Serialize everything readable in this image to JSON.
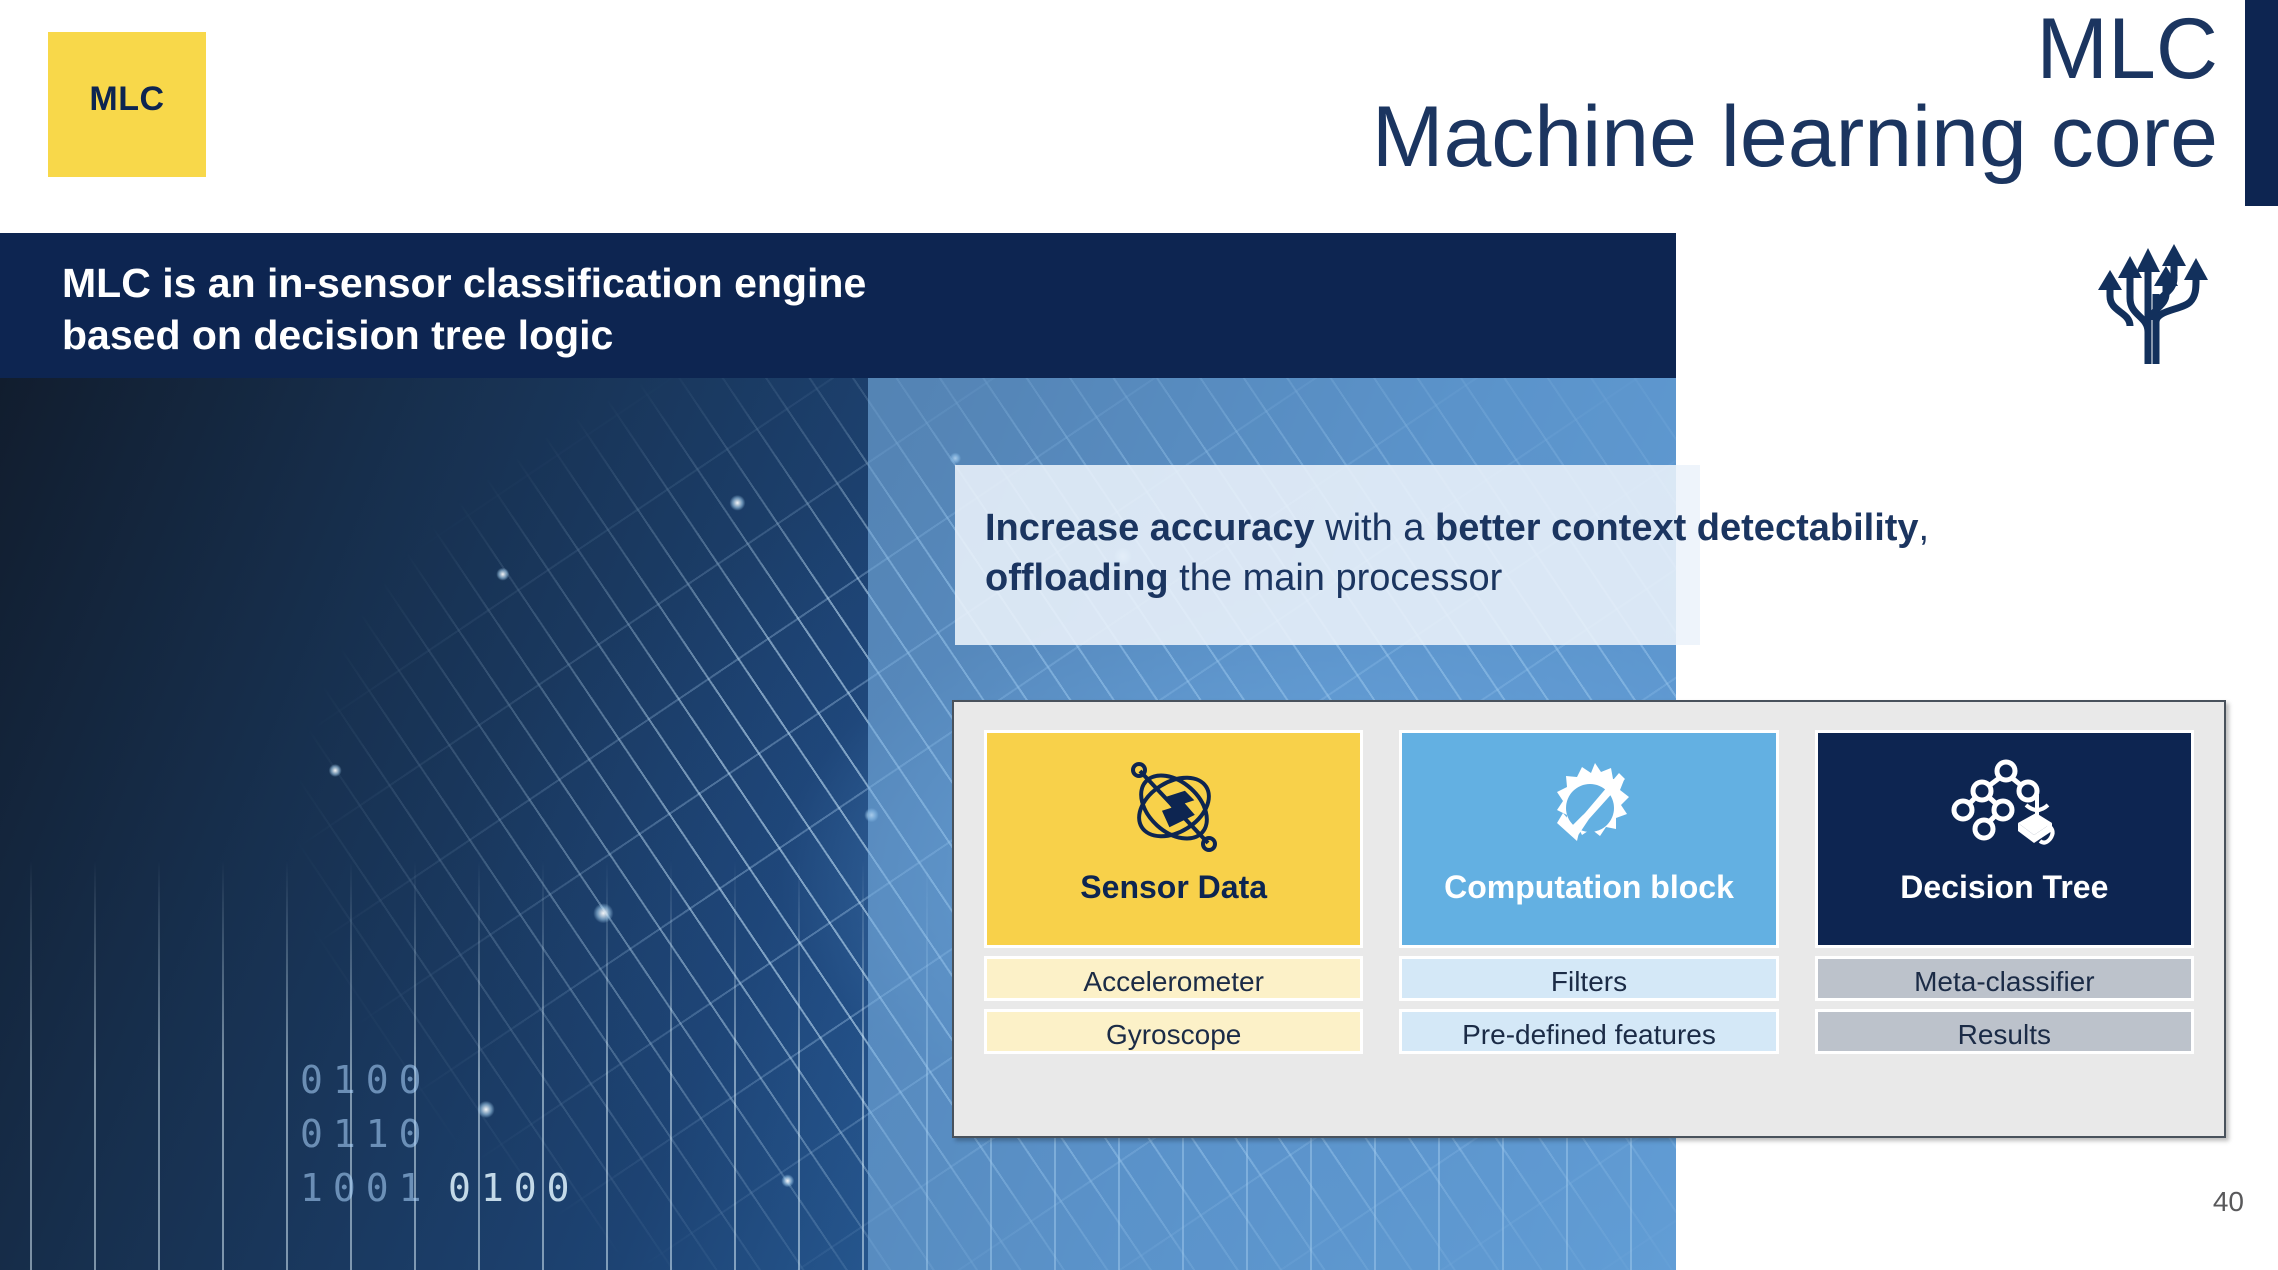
{
  "slide": {
    "page_number": "40",
    "logo_chip": {
      "label": "MLC",
      "bg_color": "#f8d84a",
      "text_color": "#0d2551"
    },
    "title": {
      "line1": "MLC",
      "line2": "Machine learning core",
      "color": "#1b3560"
    },
    "banner": {
      "line1": "MLC is an in-sensor classification engine",
      "line2": "based on decision tree logic",
      "bg_color": "#0d2551",
      "text_color": "#ffffff"
    },
    "decorative_icon": "branching-arrows-icon",
    "callout": {
      "bold1": "Increase accuracy",
      "plain1": " with a ",
      "bold2": "better context detectability",
      "plain2": ",",
      "bold3": "offloading",
      "plain3": " the main processor",
      "bg_color": "#ecf3fa",
      "text_color": "#1b3560"
    },
    "background_art": {
      "description": "circuit-board brain",
      "binary_rows": [
        "0100",
        "0110",
        "1001",
        "0100"
      ]
    },
    "pipeline": {
      "panel_bg": "#e9e9e9",
      "cards": [
        {
          "title": "Sensor Data",
          "icon": "gyroscope-orbit-icon",
          "head_color": "#f8d14a",
          "sub_color": "#fcf1c8",
          "items": [
            "Accelerometer",
            "Gyroscope"
          ]
        },
        {
          "title": "Computation block",
          "icon": "gear-check-icon",
          "head_color": "#63b0e2",
          "sub_color": "#d4e8f7",
          "items": [
            "Filters",
            "Pre-defined features"
          ]
        },
        {
          "title": "Decision Tree",
          "icon": "decision-tree-icon",
          "head_color": "#0d2551",
          "sub_color": "#bcc2cb",
          "items": [
            "Meta-classifier",
            "Results"
          ]
        }
      ]
    }
  }
}
